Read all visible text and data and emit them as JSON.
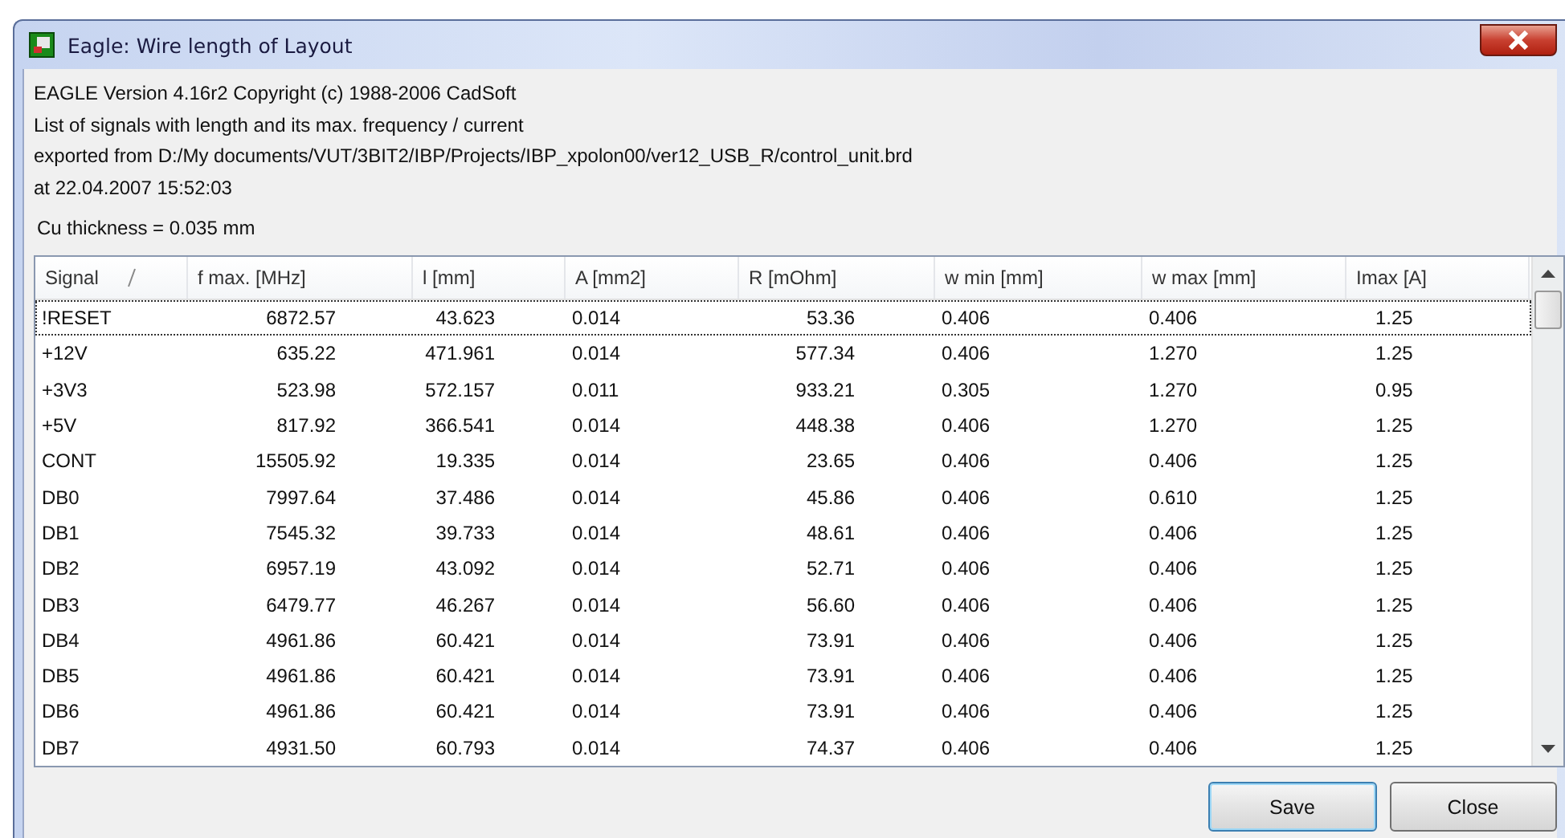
{
  "window": {
    "title": "Eagle: Wire length of Layout"
  },
  "info_lines": [
    "EAGLE Version 4.16r2 Copyright (c) 1988-2006 CadSoft",
    "List of signals with length and its max. frequency / current",
    "exported from D:/My documents/VUT/3BIT2/IBP/Projects/IBP_xpolon00/ver12_USB_R/control_unit.brd",
    "at 22.04.2007 15:52:03"
  ],
  "cu_thickness": "Cu thickness = 0.035 mm",
  "table": {
    "columns": [
      {
        "label": "Signal",
        "sorted": true
      },
      {
        "label": "f max. [MHz]",
        "sorted": false
      },
      {
        "label": "l [mm]",
        "sorted": false
      },
      {
        "label": "A [mm2]",
        "sorted": false
      },
      {
        "label": "R [mOhm]",
        "sorted": false
      },
      {
        "label": "w min [mm]",
        "sorted": false
      },
      {
        "label": "w max [mm]",
        "sorted": false
      },
      {
        "label": "Imax [A]",
        "sorted": false
      }
    ],
    "rows": [
      {
        "selected": true,
        "cells": [
          "!RESET",
          "6872.57",
          "43.623",
          "0.014",
          "53.36",
          "0.406",
          "0.406",
          "1.25"
        ]
      },
      {
        "selected": false,
        "cells": [
          "+12V",
          "635.22",
          "471.961",
          "0.014",
          "577.34",
          "0.406",
          "1.270",
          "1.25"
        ]
      },
      {
        "selected": false,
        "cells": [
          "+3V3",
          "523.98",
          "572.157",
          "0.011",
          "933.21",
          "0.305",
          "1.270",
          "0.95"
        ]
      },
      {
        "selected": false,
        "cells": [
          "+5V",
          "817.92",
          "366.541",
          "0.014",
          "448.38",
          "0.406",
          "1.270",
          "1.25"
        ]
      },
      {
        "selected": false,
        "cells": [
          "CONT",
          "15505.92",
          "19.335",
          "0.014",
          "23.65",
          "0.406",
          "0.406",
          "1.25"
        ]
      },
      {
        "selected": false,
        "cells": [
          "DB0",
          "7997.64",
          "37.486",
          "0.014",
          "45.86",
          "0.406",
          "0.610",
          "1.25"
        ]
      },
      {
        "selected": false,
        "cells": [
          "DB1",
          "7545.32",
          "39.733",
          "0.014",
          "48.61",
          "0.406",
          "0.406",
          "1.25"
        ]
      },
      {
        "selected": false,
        "cells": [
          "DB2",
          "6957.19",
          "43.092",
          "0.014",
          "52.71",
          "0.406",
          "0.406",
          "1.25"
        ]
      },
      {
        "selected": false,
        "cells": [
          "DB3",
          "6479.77",
          "46.267",
          "0.014",
          "56.60",
          "0.406",
          "0.406",
          "1.25"
        ]
      },
      {
        "selected": false,
        "cells": [
          "DB4",
          "4961.86",
          "60.421",
          "0.014",
          "73.91",
          "0.406",
          "0.406",
          "1.25"
        ]
      },
      {
        "selected": false,
        "cells": [
          "DB5",
          "4961.86",
          "60.421",
          "0.014",
          "73.91",
          "0.406",
          "0.406",
          "1.25"
        ]
      },
      {
        "selected": false,
        "cells": [
          "DB6",
          "4961.86",
          "60.421",
          "0.014",
          "73.91",
          "0.406",
          "0.406",
          "1.25"
        ]
      },
      {
        "selected": false,
        "cells": [
          "DB7",
          "4931.50",
          "60.793",
          "0.014",
          "74.37",
          "0.406",
          "0.406",
          "1.25"
        ]
      }
    ]
  },
  "buttons": [
    {
      "label": "Save",
      "default": true
    },
    {
      "label": "Close",
      "default": false
    }
  ]
}
